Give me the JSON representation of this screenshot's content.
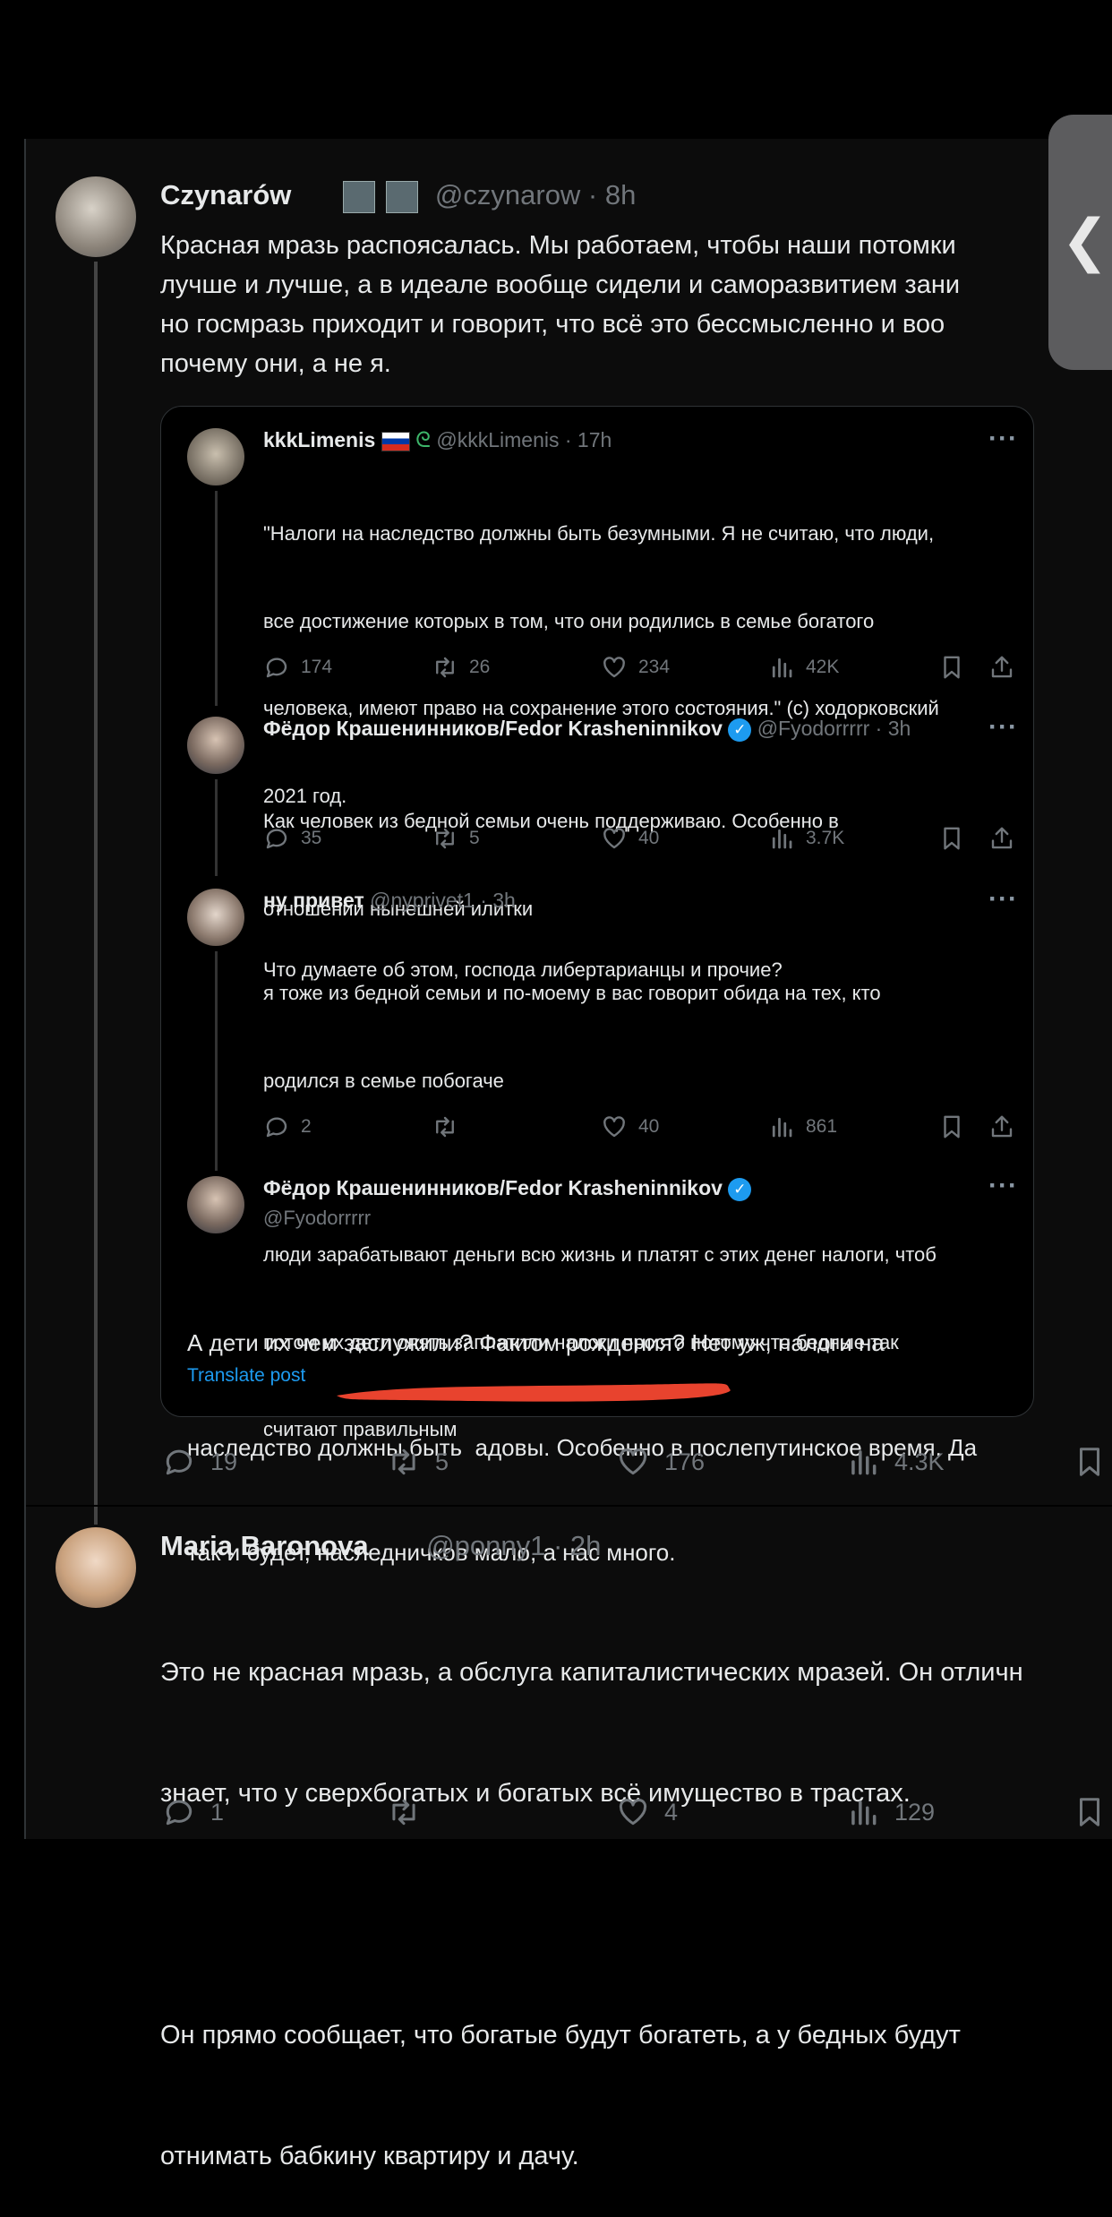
{
  "main_tweet": {
    "name": "Czynarów",
    "handle_time": "@czynarow · 8h",
    "lines": [
      "Красная мразь распоясалась. Мы работаем, чтобы наши потомки",
      "лучше и лучше, а в идеале вообще сидели и саморазвитием зани",
      "но госмразь приходит и говорит, что всё это бессмысленно и воо",
      "почему они, а не я."
    ],
    "stats": {
      "replies": "19",
      "reposts": "5",
      "likes": "176",
      "views": "4.3K"
    }
  },
  "quote": {
    "t1": {
      "name": "kkkLimenis",
      "handle_time": "@kkkLimenis · 17h",
      "lines": [
        "\"Налоги на наследство должны быть безумными. Я не считаю, что люди,",
        "все достижение которых в том, что они родились в семье богатого",
        "человека, имеют право на сохранение этого состояния.\" (с) ходорковский",
        "2021 год.",
        "",
        "Что думаете об этом, господа либертарианцы и прочие?"
      ],
      "stats": {
        "replies": "174",
        "reposts": "26",
        "likes": "234",
        "views": "42K"
      }
    },
    "t2": {
      "name": "Фёдор Крашенинников/Fedor Krasheninnikov",
      "handle_time": "@Fyodorrrrr · 3h",
      "lines": [
        "Как человек из бедной семьи очень поддерживаю. Особенно в",
        "отношении нынешней илитки"
      ],
      "stats": {
        "replies": "35",
        "reposts": "5",
        "likes": "40",
        "views": "3.7K"
      }
    },
    "t3": {
      "name": "ну привет",
      "handle_time": "@nyprivet1 · 3h",
      "lines": [
        "я тоже из бедной семьи и по-моему в вас говорит обида на тех, кто",
        "родился в семье побогаче",
        "",
        "люди зарабатывают деньги всю жизнь и платят с этих денег налоги, чтоб",
        "потом их дети опять заплатили налоги просто потому что бедные так",
        "считают правильным"
      ],
      "stats": {
        "replies": "2",
        "reposts": "",
        "likes": "40",
        "views": "861"
      }
    },
    "t4": {
      "name": "Фёдор Крашенинников/Fedor Krasheninnikov",
      "handle": "@Fyodorrrrr",
      "lines": [
        "А дети их чем заслужили? Фактом рождения? Нет уж, налоги на",
        "наследство должны быть  адовы. Особенно в послепутинское время. Да",
        "так и будет, наследничков мало, а нас много."
      ],
      "translate": "Translate post"
    },
    "more": "···"
  },
  "reply": {
    "name": "Maria Baronova",
    "handle_time": "@ponny1 · 2h",
    "lines": [
      "Это не красная мразь, а обслуга капиталистических мразей. Он отличн",
      "знает, что у сверхбогатых и богатых всё имущество в трастах.",
      "",
      "Он прямо сообщает, что богатые будут богатеть, а у бедных будут",
      "отнимать бабкину квартиру и дачу."
    ],
    "stats": {
      "replies": "1",
      "reposts": "",
      "likes": "4",
      "views": "129"
    }
  },
  "icons": [
    "reply-icon",
    "repost-icon",
    "like-icon",
    "views-icon",
    "bookmark-icon",
    "share-icon",
    "back-chevron-icon",
    "verified-icon"
  ],
  "colors": {
    "background": "#000000",
    "card": "#0c0c0c",
    "muted": "#71767b",
    "link": "#1d9bf0",
    "red_mark": "#e8432e"
  },
  "back_glyph": "❮"
}
